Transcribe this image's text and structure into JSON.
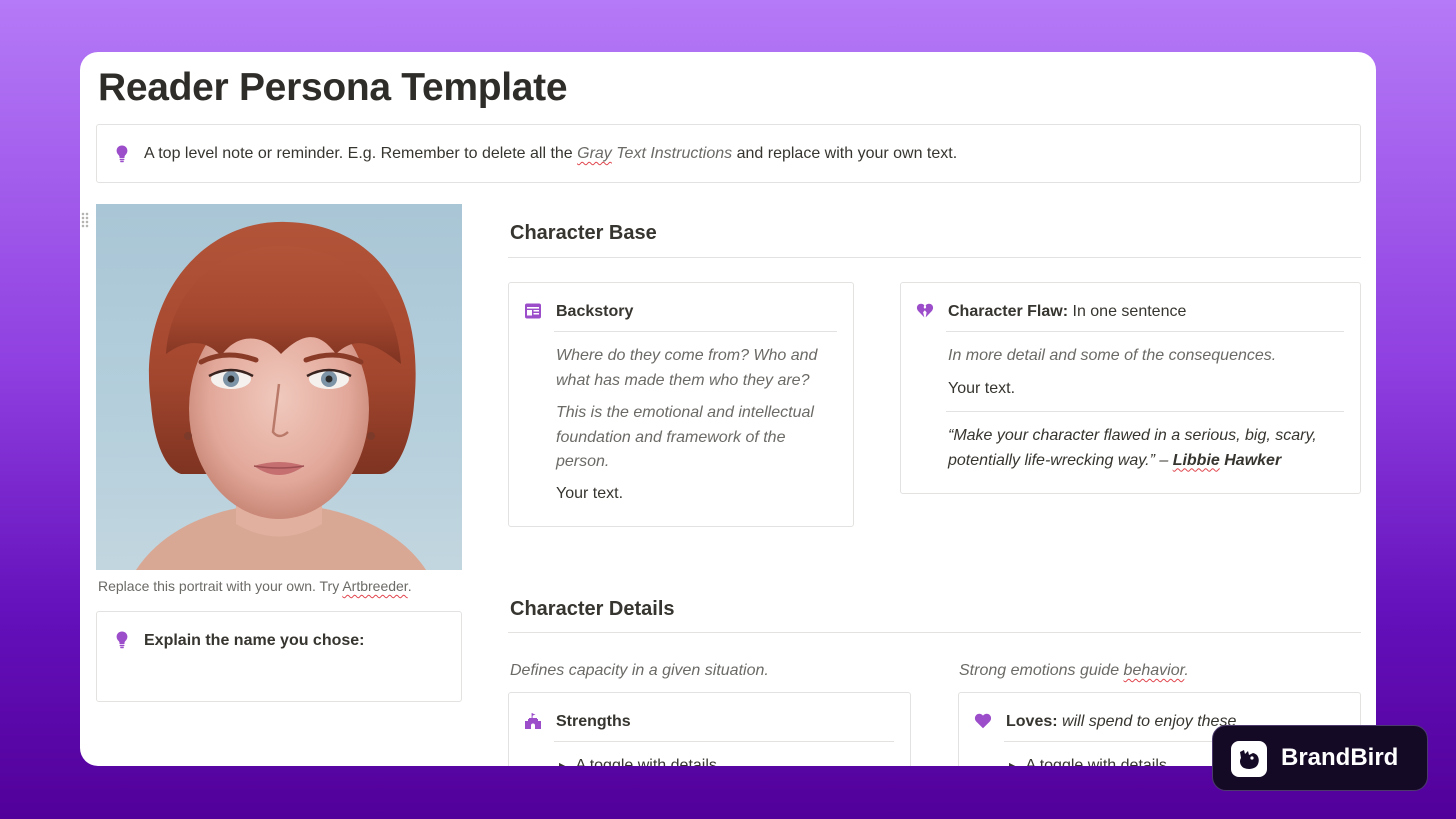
{
  "page": {
    "title": "Reader Persona Template",
    "top_note": {
      "icon": "lightbulb-icon",
      "prefix": "A top level note or reminder. E.g. Remember to delete all the ",
      "gray_word": "Gray",
      "gray_rest": " Text Instructions",
      "suffix": " and replace with your own text."
    },
    "portrait": {
      "caption_prefix": "Replace this portrait with your own. Try ",
      "caption_link": "Artbreeder",
      "caption_suffix": "."
    },
    "name_callout": {
      "icon": "lightbulb-icon",
      "text": "Explain the name you chose:"
    }
  },
  "character_base": {
    "heading": "Character Base",
    "backstory": {
      "icon": "calendar-icon",
      "title": "Backstory",
      "q1": "Where do they come from? Who and what has made them who they are?",
      "q2": "This is the emotional and intellectual foundation and framework of the person.",
      "your_text": "Your text."
    },
    "flaw": {
      "icon": "broken-heart-icon",
      "label": "Character Flaw:",
      "rest": " In one sentence",
      "detail": "In more detail and some of the consequences.",
      "your_text": "Your text.",
      "quote": "“Make your character flawed in a serious, big, scary, potentially life-wrecking way.” – ",
      "author_first": "Libbie",
      "author_last": " Hawker"
    }
  },
  "character_details": {
    "heading": "Character Details",
    "left_sub": "Defines capacity in a given situation.",
    "right_sub_prefix": "Strong emotions guide ",
    "right_sub_word": "behavior",
    "right_sub_suffix": ".",
    "strengths": {
      "icon": "castle-icon",
      "title": "Strengths",
      "toggle": "A toggle with details"
    },
    "loves": {
      "icon": "purple-heart-icon",
      "label": "Loves:",
      "rest": " will spend to enjoy these",
      "toggle": "A toggle with details"
    }
  },
  "watermark": {
    "logo": "brandbird-logo",
    "text": "BrandBird"
  },
  "colors": {
    "accent_purple": "#9b4dca",
    "background_top": "#b57af7",
    "background_bottom": "#52009a",
    "card_border": "#e3e2e0"
  }
}
